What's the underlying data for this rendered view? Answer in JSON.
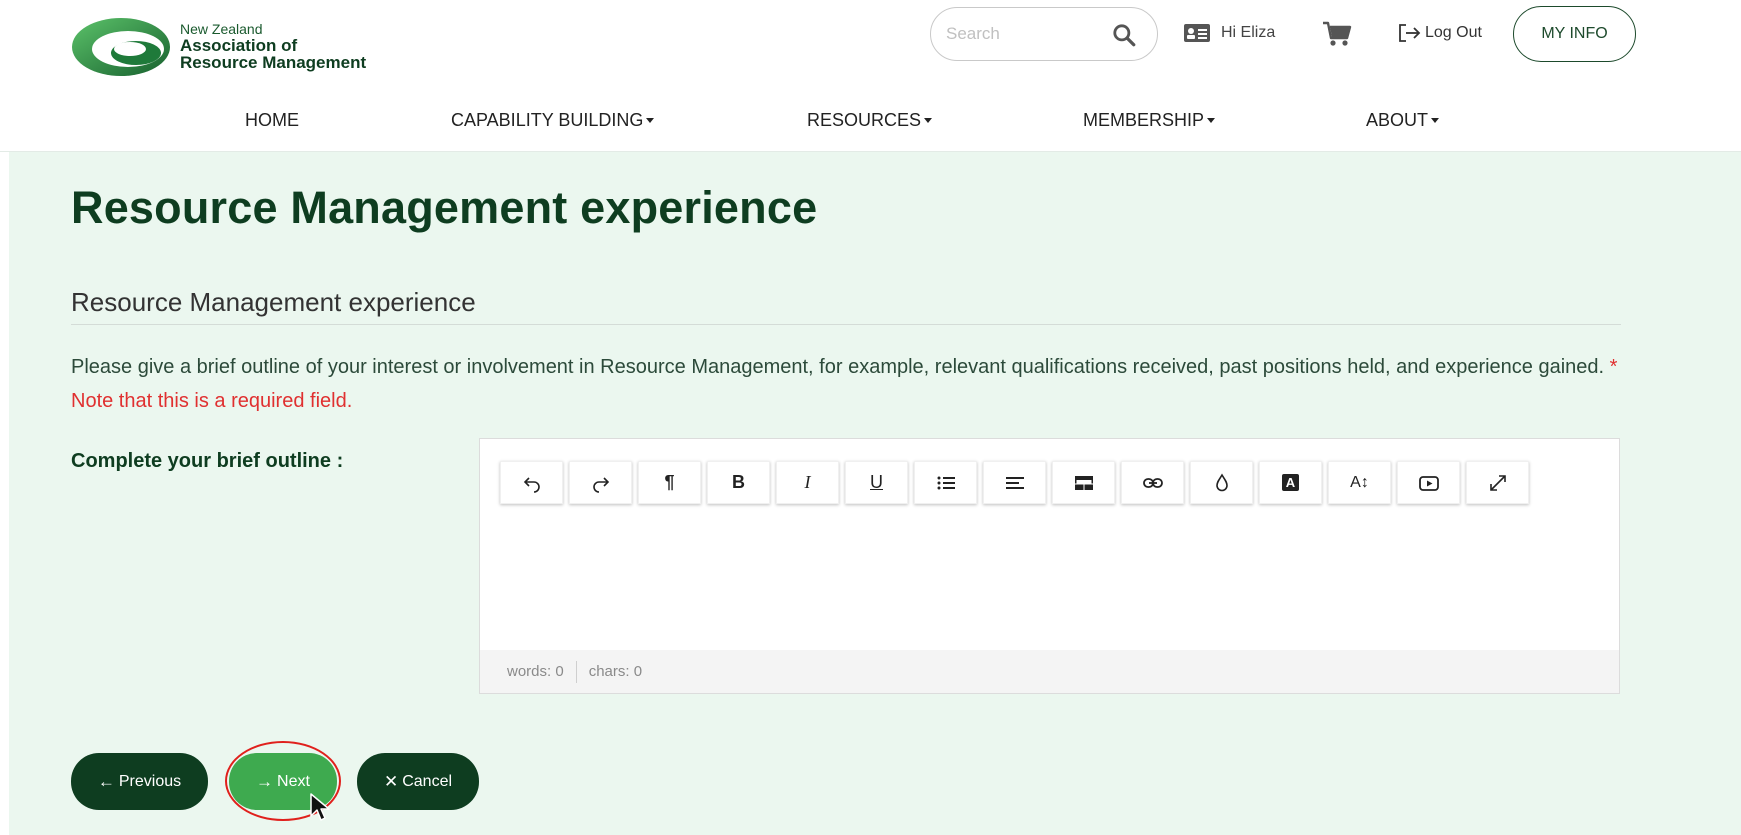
{
  "logo": {
    "line1": "New Zealand",
    "line2": "Association of",
    "line3": "Resource Management"
  },
  "search": {
    "placeholder": "Search",
    "value": ""
  },
  "user": {
    "greeting": "Hi Eliza"
  },
  "header_actions": {
    "logout": "Log Out",
    "myinfo": "MY INFO"
  },
  "nav": {
    "items": [
      {
        "label": "HOME",
        "dropdown": false
      },
      {
        "label": "CAPABILITY BUILDING",
        "dropdown": true
      },
      {
        "label": "RESOURCES",
        "dropdown": true
      },
      {
        "label": "MEMBERSHIP",
        "dropdown": true
      },
      {
        "label": "ABOUT",
        "dropdown": true
      }
    ]
  },
  "page": {
    "title": "Resource Management experience",
    "section_title": "Resource Management experience",
    "intro": "Please give a brief outline of your interest or involvement in Resource Management, for example, relevant qualifications received, past positions held, and experience gained.",
    "required_note": "* Note that this is a required field.",
    "field_label": "Complete your brief outline :"
  },
  "editor": {
    "toolbar": [
      "undo-icon",
      "redo-icon",
      "paragraph-icon",
      "bold-icon",
      "italic-icon",
      "underline-icon",
      "list-icon",
      "align-icon",
      "table-icon",
      "link-icon",
      "color-icon",
      "highlight-icon",
      "font-size-icon",
      "video-icon",
      "fullscreen-icon"
    ],
    "toolbar_text": {
      "paragraph": "¶",
      "bold": "B",
      "italic": "I",
      "underline": "U",
      "highlight": "A",
      "font_size": "A↕"
    },
    "value": "",
    "words": "words: 0",
    "chars": "chars: 0"
  },
  "buttons": {
    "previous": "Previous",
    "next": "Next",
    "cancel": "Cancel"
  },
  "colors": {
    "brand_dark": "#0e3d20",
    "brand_green": "#3eaa4f",
    "page_bg": "#ebf7ef",
    "required": "#e03030",
    "highlight_ring": "#e0201c"
  }
}
